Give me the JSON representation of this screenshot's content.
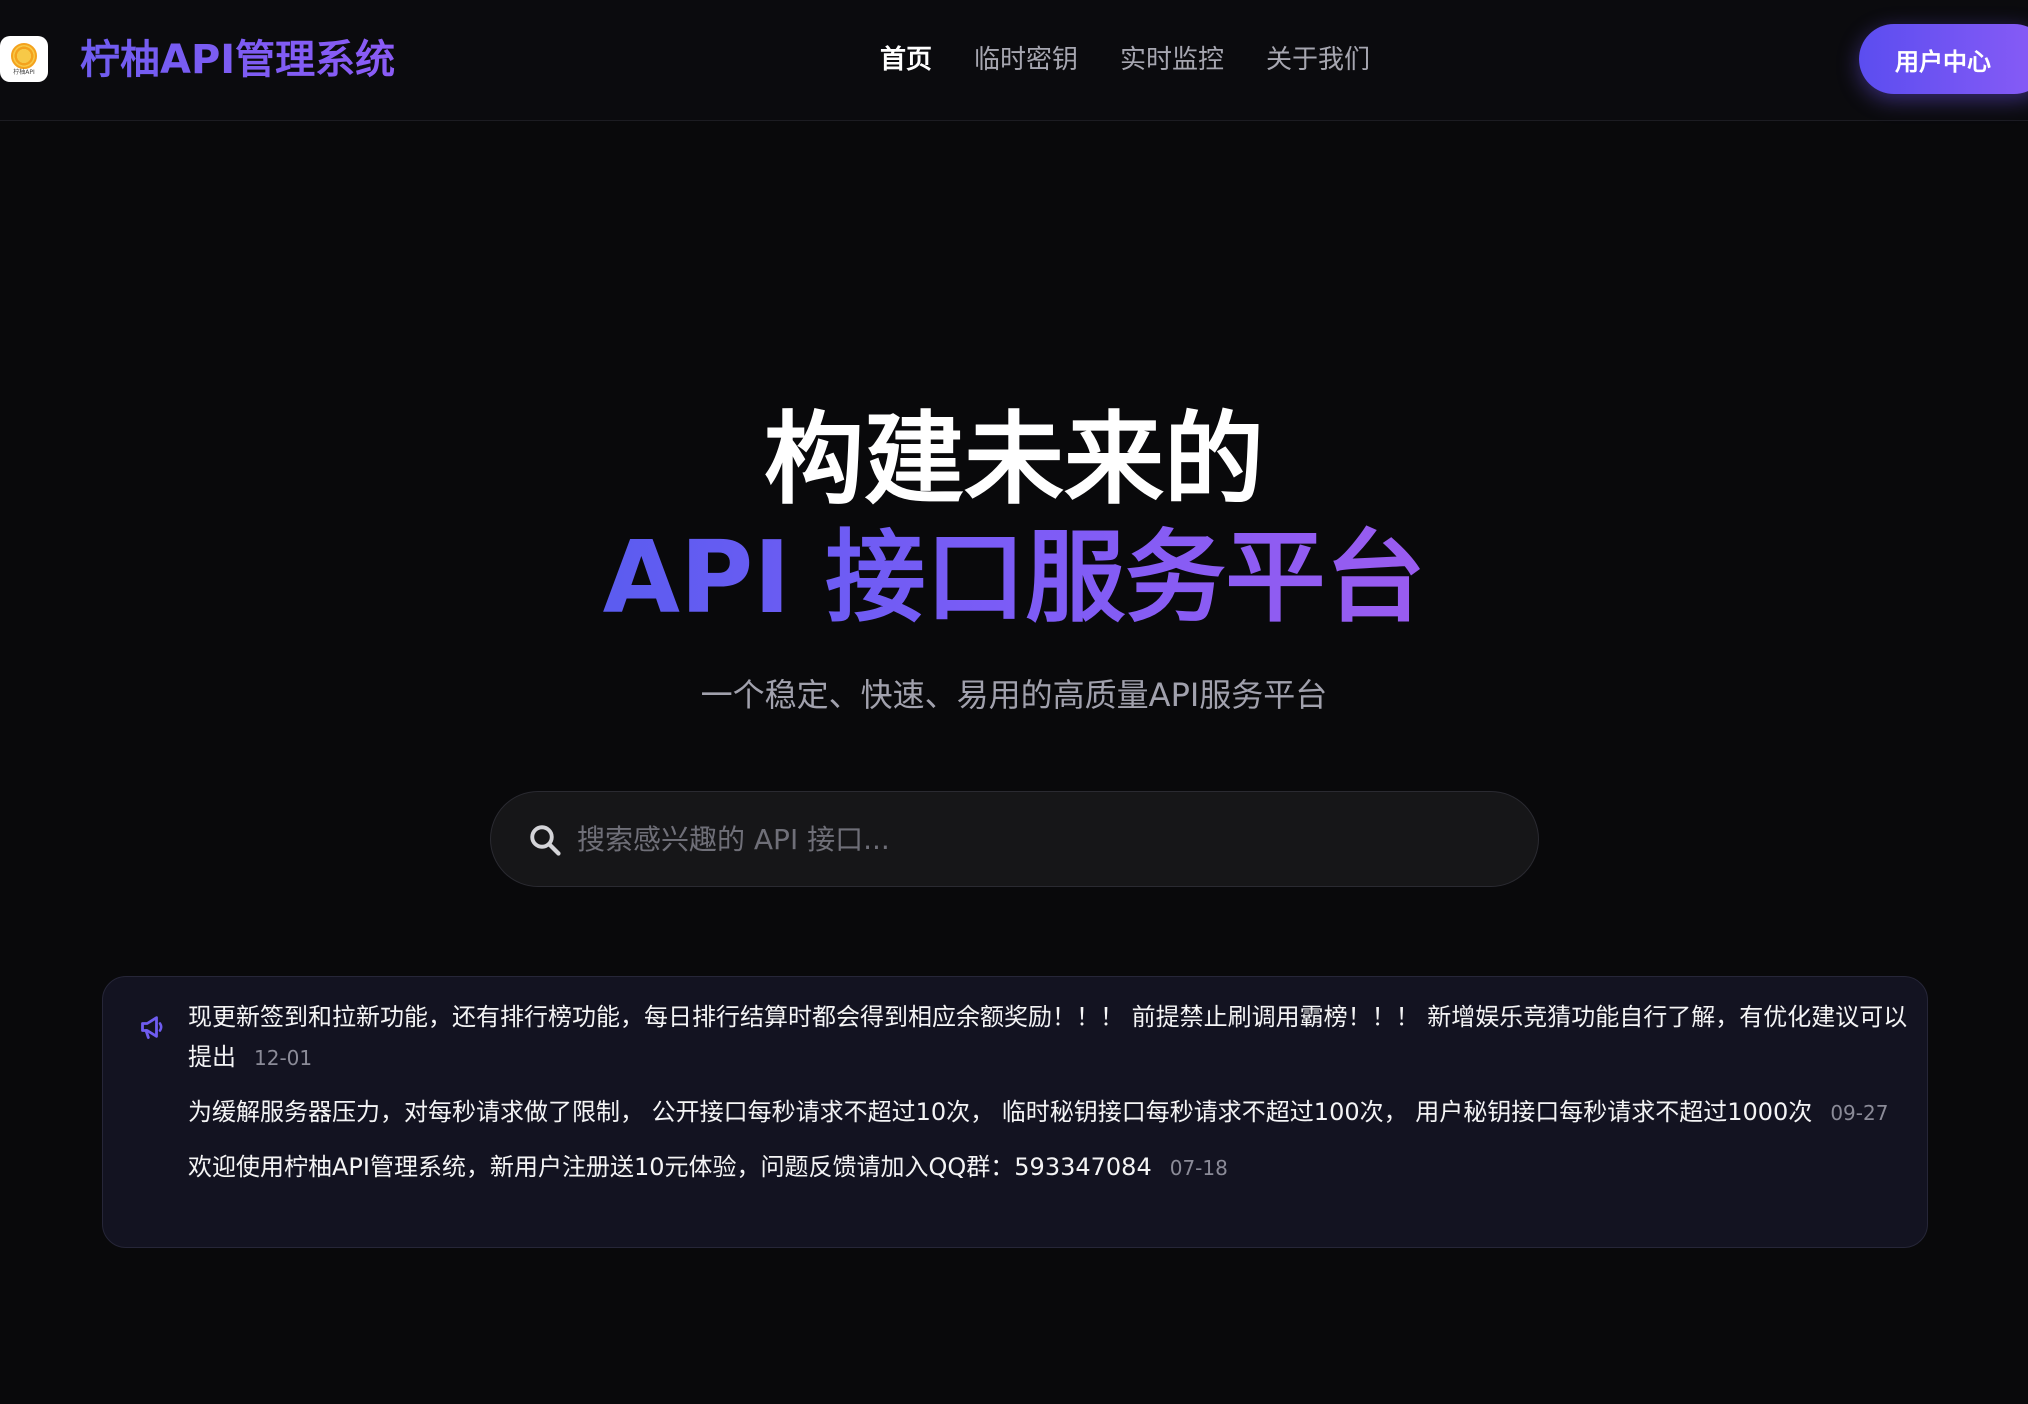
{
  "header": {
    "logo_text": "柠柚API",
    "brand": "柠柚API管理系统",
    "nav": [
      {
        "label": "首页",
        "active": true
      },
      {
        "label": "临时密钥",
        "active": false
      },
      {
        "label": "实时监控",
        "active": false
      },
      {
        "label": "关于我们",
        "active": false
      }
    ],
    "user_center": "用户中心"
  },
  "hero": {
    "line1": "构建未来的",
    "line2": "API 接口服务平台",
    "subtitle": "一个稳定、快速、易用的高质量API服务平台"
  },
  "search": {
    "placeholder": "搜索感兴趣的 API 接口...",
    "value": ""
  },
  "announcements": [
    {
      "text": "现更新签到和拉新功能，还有排行榜功能，每日排行结算时都会得到相应余额奖励！！！ 前提禁止刷调用霸榜！！！ 新增娱乐竞猜功能自行了解，有优化建议可以提出",
      "date": "12-01"
    },
    {
      "text": "为缓解服务器压力，对每秒请求做了限制， 公开接口每秒请求不超过10次， 临时秘钥接口每秒请求不超过100次， 用户秘钥接口每秒请求不超过1000次",
      "date": "09-27"
    },
    {
      "text": "欢迎使用柠柚API管理系统，新用户注册送10元体验，问题反馈请加入QQ群：593347084",
      "date": "07-18"
    }
  ],
  "colors": {
    "background": "#09090b",
    "accent": "#6f5cf0",
    "accent_end": "#8b5cf6",
    "notice_bg": "#131321"
  },
  "icons": {
    "logo": "sun-logo-icon",
    "search": "search-icon",
    "notice": "megaphone-icon"
  }
}
